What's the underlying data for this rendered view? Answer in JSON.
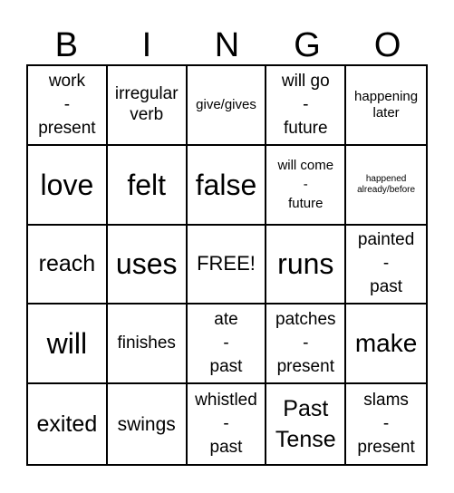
{
  "header": {
    "letters": [
      "B",
      "I",
      "N",
      "G",
      "O"
    ]
  },
  "cells": [
    "work\n-\npresent",
    "irregular\nverb",
    "give/gives",
    "will go\n-\nfuture",
    "happening\nlater",
    "love",
    "felt",
    "false",
    "will come\n-\nfuture",
    "happened\nalready/before",
    "reach",
    "uses",
    "FREE!",
    "runs",
    "painted\n-\npast",
    "will",
    "finishes",
    "ate\n-\npast",
    "patches\n-\npresent",
    "make",
    "exited",
    "swings",
    "whistled\n-\npast",
    "Past\nTense",
    "slams\n-\npresent"
  ]
}
